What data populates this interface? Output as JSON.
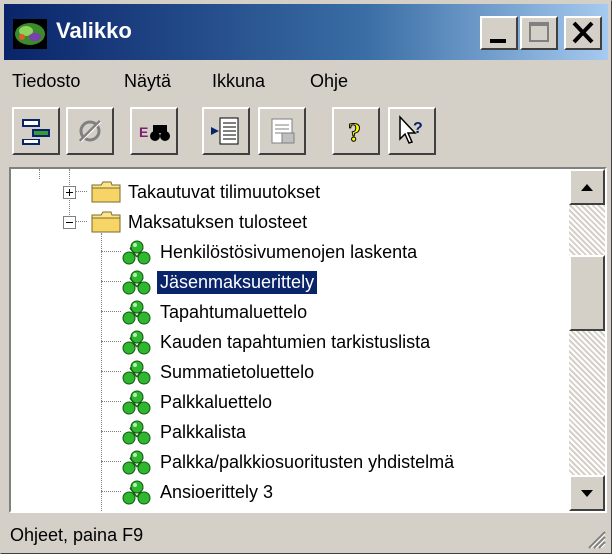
{
  "window": {
    "title": "Valikko"
  },
  "menu": [
    "Tiedosto",
    "Näytä",
    "Ikkuna",
    "Ohje"
  ],
  "toolbar": {
    "buttons": [
      {
        "icon": "tree-view-icon",
        "enabled": true
      },
      {
        "icon": "disabled-action-icon",
        "enabled": false
      },
      {
        "icon": "find-icon",
        "enabled": true
      },
      {
        "icon": "indent-list-icon",
        "enabled": true
      },
      {
        "icon": "properties-icon",
        "enabled": false
      },
      {
        "icon": "help-icon",
        "enabled": true
      },
      {
        "icon": "context-help-icon",
        "enabled": true
      }
    ]
  },
  "tree": {
    "folders": [
      {
        "label": "Takautuvat tilimuutokset",
        "expanded": false
      },
      {
        "label": "Maksatuksen tulosteet",
        "expanded": true
      }
    ],
    "items": [
      "Henkilöstösivumenojen laskenta",
      "Jäsenmaksuerittely",
      "Tapahtumaluettelo",
      "Kauden tapahtumien tarkistuslista",
      "Summatietoluettelo",
      "Palkkaluettelo",
      "Palkkalista",
      "Palkka/palkkiosuoritusten yhdistelmä",
      "Ansioerittely 3"
    ],
    "selected": "Jäsenmaksuerittely"
  },
  "status": {
    "text": "Ohjeet, paina F9"
  },
  "colors": {
    "titlebar_start": "#0a246a",
    "titlebar_end": "#a6caf0",
    "selection": "#0a246a",
    "face": "#d4d0c8"
  }
}
